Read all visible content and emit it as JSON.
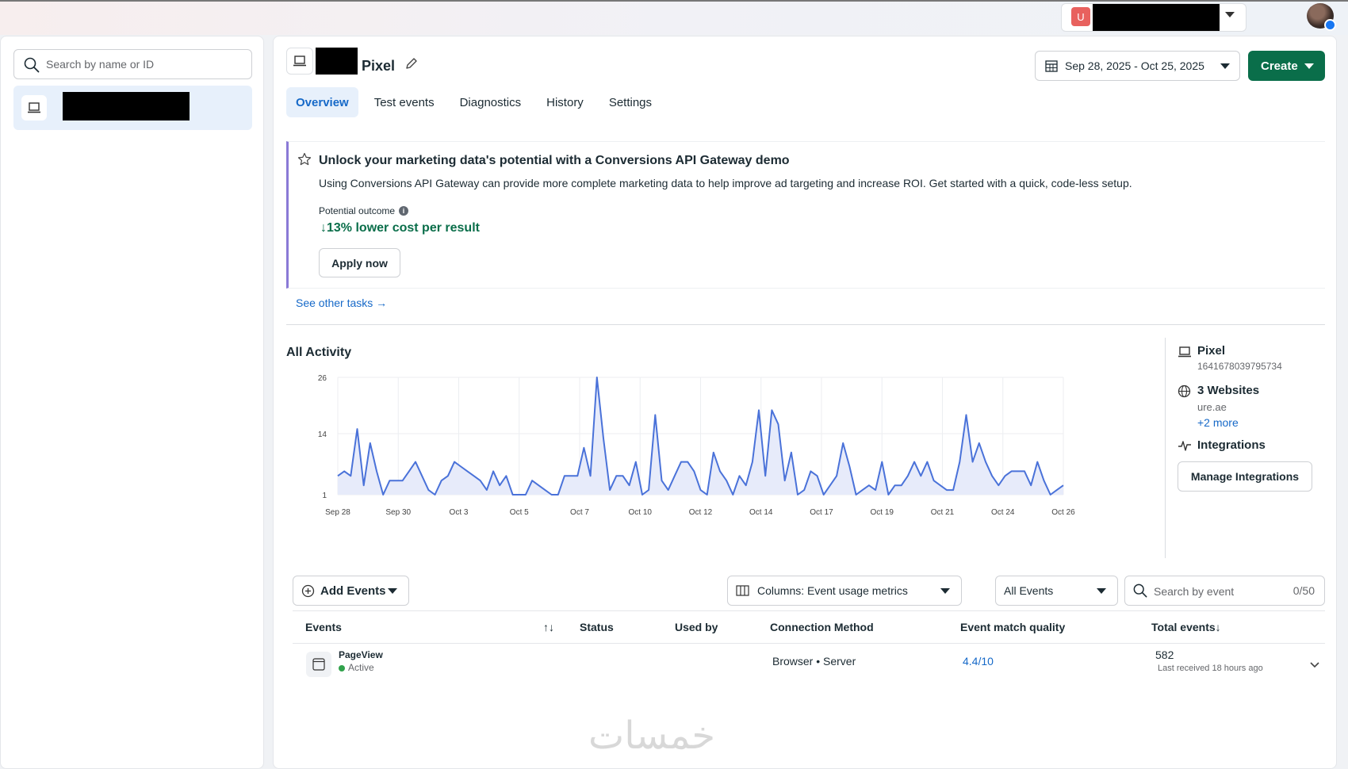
{
  "topbar": {
    "account_badge": "U"
  },
  "left": {
    "search_placeholder": "Search by name or ID"
  },
  "header": {
    "title": "Pixel",
    "date_range": "Sep 28, 2025 - Oct 25, 2025",
    "create_label": "Create"
  },
  "tabs": [
    "Overview",
    "Test events",
    "Diagnostics",
    "History",
    "Settings"
  ],
  "promo": {
    "title": "Unlock your marketing data's potential with a Conversions API Gateway demo",
    "description": "Using Conversions API Gateway can provide more complete marketing data to help improve ad targeting and increase ROI. Get started with a quick, code-less setup.",
    "outcome_label": "Potential outcome",
    "metric": "13% lower cost per result",
    "apply_label": "Apply now",
    "see_other": "See other tasks"
  },
  "activity": {
    "title": "All Activity"
  },
  "chart_data": {
    "type": "area",
    "x_ticks": [
      "Sep 28",
      "Sep 30",
      "Oct 3",
      "Oct 5",
      "Oct 7",
      "Oct 10",
      "Oct 12",
      "Oct 14",
      "Oct 17",
      "Oct 19",
      "Oct 21",
      "Oct 24",
      "Oct 26"
    ],
    "y_ticks": [
      1,
      14,
      26
    ],
    "ylim": [
      1,
      26
    ],
    "color": "#4a72d9",
    "fill": "#e7ebfa",
    "values": [
      5,
      6,
      5,
      15,
      3,
      12,
      6,
      1,
      4,
      4,
      4,
      6,
      8,
      5,
      2,
      1,
      4,
      5,
      8,
      7,
      6,
      5,
      4,
      2,
      6,
      3,
      5,
      1,
      1,
      1,
      4,
      3,
      2,
      1,
      1,
      5,
      5,
      5,
      11,
      5,
      26,
      13,
      2,
      5,
      5,
      3,
      8,
      1,
      2,
      18,
      4,
      2,
      5,
      8,
      8,
      6,
      2,
      1,
      10,
      6,
      4,
      1,
      5,
      3,
      8,
      19,
      5,
      19,
      16,
      4,
      10,
      1,
      2,
      6,
      5,
      1,
      3,
      5,
      12,
      7,
      1,
      2,
      3,
      2,
      8,
      1,
      3,
      3,
      5,
      8,
      5,
      8,
      4,
      3,
      2,
      2,
      8,
      18,
      8,
      12,
      8,
      5,
      3,
      5,
      6,
      6,
      6,
      3,
      8,
      4,
      1,
      2,
      3
    ]
  },
  "side": {
    "pixel_name": "Pixel",
    "pixel_id": "1641678039795734",
    "websites_label": "3 Websites",
    "website_domain": "ure.ae",
    "more_link": "+2 more",
    "integrations_label": "Integrations",
    "manage_label": "Manage Integrations"
  },
  "controls": {
    "add_events": "Add Events",
    "columns": "Columns: Event usage metrics",
    "filter": "All Events",
    "search_placeholder": "Search by event",
    "search_count": "0/50"
  },
  "table": {
    "headers": {
      "events": "Events",
      "status": "Status",
      "used_by": "Used by",
      "connection": "Connection Method",
      "quality": "Event match quality",
      "total": "Total events"
    },
    "rows": [
      {
        "name": "PageView",
        "state": "Active",
        "connection": "Browser • Server",
        "quality": "4.4/10",
        "total": "582",
        "last_received": "Last received 18 hours ago"
      }
    ]
  },
  "watermark": "خمسات"
}
